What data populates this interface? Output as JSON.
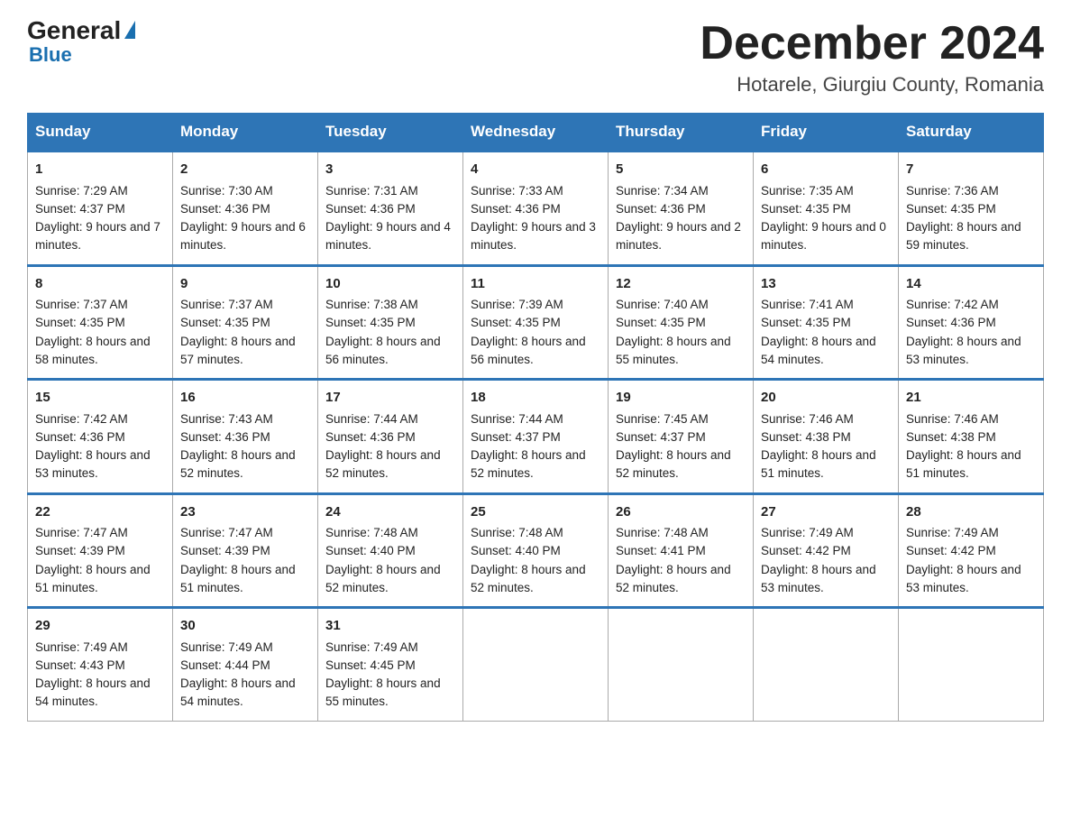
{
  "header": {
    "logo_general": "General",
    "logo_blue": "Blue",
    "month_year": "December 2024",
    "location": "Hotarele, Giurgiu County, Romania"
  },
  "days_of_week": [
    "Sunday",
    "Monday",
    "Tuesday",
    "Wednesday",
    "Thursday",
    "Friday",
    "Saturday"
  ],
  "weeks": [
    [
      {
        "day": "1",
        "sunrise": "7:29 AM",
        "sunset": "4:37 PM",
        "daylight": "9 hours and 7 minutes."
      },
      {
        "day": "2",
        "sunrise": "7:30 AM",
        "sunset": "4:36 PM",
        "daylight": "9 hours and 6 minutes."
      },
      {
        "day": "3",
        "sunrise": "7:31 AM",
        "sunset": "4:36 PM",
        "daylight": "9 hours and 4 minutes."
      },
      {
        "day": "4",
        "sunrise": "7:33 AM",
        "sunset": "4:36 PM",
        "daylight": "9 hours and 3 minutes."
      },
      {
        "day": "5",
        "sunrise": "7:34 AM",
        "sunset": "4:36 PM",
        "daylight": "9 hours and 2 minutes."
      },
      {
        "day": "6",
        "sunrise": "7:35 AM",
        "sunset": "4:35 PM",
        "daylight": "9 hours and 0 minutes."
      },
      {
        "day": "7",
        "sunrise": "7:36 AM",
        "sunset": "4:35 PM",
        "daylight": "8 hours and 59 minutes."
      }
    ],
    [
      {
        "day": "8",
        "sunrise": "7:37 AM",
        "sunset": "4:35 PM",
        "daylight": "8 hours and 58 minutes."
      },
      {
        "day": "9",
        "sunrise": "7:37 AM",
        "sunset": "4:35 PM",
        "daylight": "8 hours and 57 minutes."
      },
      {
        "day": "10",
        "sunrise": "7:38 AM",
        "sunset": "4:35 PM",
        "daylight": "8 hours and 56 minutes."
      },
      {
        "day": "11",
        "sunrise": "7:39 AM",
        "sunset": "4:35 PM",
        "daylight": "8 hours and 56 minutes."
      },
      {
        "day": "12",
        "sunrise": "7:40 AM",
        "sunset": "4:35 PM",
        "daylight": "8 hours and 55 minutes."
      },
      {
        "day": "13",
        "sunrise": "7:41 AM",
        "sunset": "4:35 PM",
        "daylight": "8 hours and 54 minutes."
      },
      {
        "day": "14",
        "sunrise": "7:42 AM",
        "sunset": "4:36 PM",
        "daylight": "8 hours and 53 minutes."
      }
    ],
    [
      {
        "day": "15",
        "sunrise": "7:42 AM",
        "sunset": "4:36 PM",
        "daylight": "8 hours and 53 minutes."
      },
      {
        "day": "16",
        "sunrise": "7:43 AM",
        "sunset": "4:36 PM",
        "daylight": "8 hours and 52 minutes."
      },
      {
        "day": "17",
        "sunrise": "7:44 AM",
        "sunset": "4:36 PM",
        "daylight": "8 hours and 52 minutes."
      },
      {
        "day": "18",
        "sunrise": "7:44 AM",
        "sunset": "4:37 PM",
        "daylight": "8 hours and 52 minutes."
      },
      {
        "day": "19",
        "sunrise": "7:45 AM",
        "sunset": "4:37 PM",
        "daylight": "8 hours and 52 minutes."
      },
      {
        "day": "20",
        "sunrise": "7:46 AM",
        "sunset": "4:38 PM",
        "daylight": "8 hours and 51 minutes."
      },
      {
        "day": "21",
        "sunrise": "7:46 AM",
        "sunset": "4:38 PM",
        "daylight": "8 hours and 51 minutes."
      }
    ],
    [
      {
        "day": "22",
        "sunrise": "7:47 AM",
        "sunset": "4:39 PM",
        "daylight": "8 hours and 51 minutes."
      },
      {
        "day": "23",
        "sunrise": "7:47 AM",
        "sunset": "4:39 PM",
        "daylight": "8 hours and 51 minutes."
      },
      {
        "day": "24",
        "sunrise": "7:48 AM",
        "sunset": "4:40 PM",
        "daylight": "8 hours and 52 minutes."
      },
      {
        "day": "25",
        "sunrise": "7:48 AM",
        "sunset": "4:40 PM",
        "daylight": "8 hours and 52 minutes."
      },
      {
        "day": "26",
        "sunrise": "7:48 AM",
        "sunset": "4:41 PM",
        "daylight": "8 hours and 52 minutes."
      },
      {
        "day": "27",
        "sunrise": "7:49 AM",
        "sunset": "4:42 PM",
        "daylight": "8 hours and 53 minutes."
      },
      {
        "day": "28",
        "sunrise": "7:49 AM",
        "sunset": "4:42 PM",
        "daylight": "8 hours and 53 minutes."
      }
    ],
    [
      {
        "day": "29",
        "sunrise": "7:49 AM",
        "sunset": "4:43 PM",
        "daylight": "8 hours and 54 minutes."
      },
      {
        "day": "30",
        "sunrise": "7:49 AM",
        "sunset": "4:44 PM",
        "daylight": "8 hours and 54 minutes."
      },
      {
        "day": "31",
        "sunrise": "7:49 AM",
        "sunset": "4:45 PM",
        "daylight": "8 hours and 55 minutes."
      },
      null,
      null,
      null,
      null
    ]
  ]
}
